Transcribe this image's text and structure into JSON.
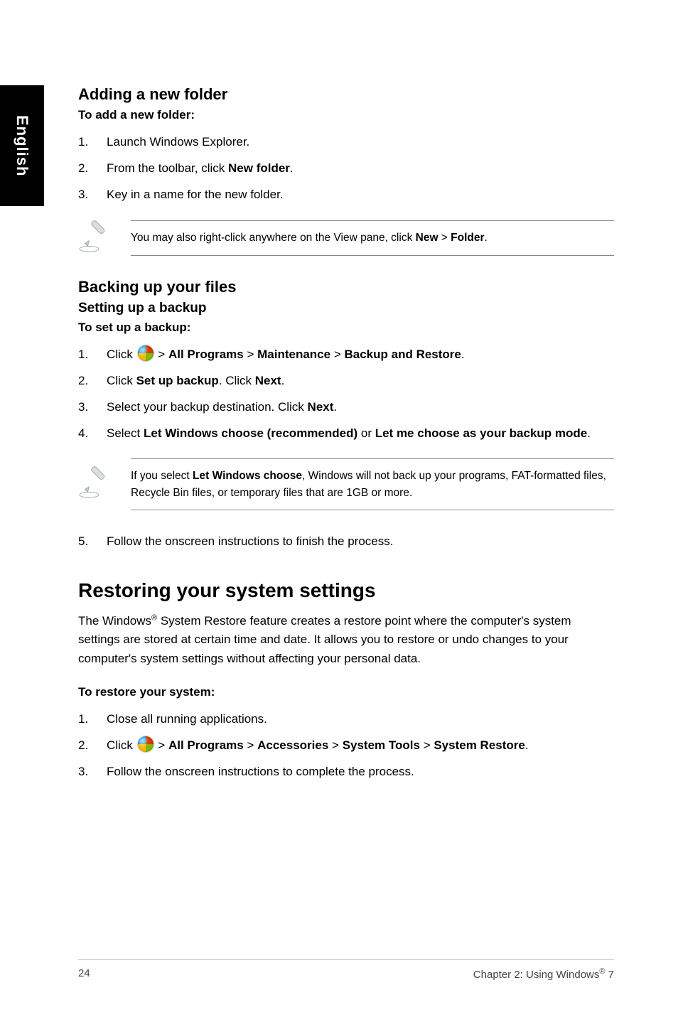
{
  "side_tab": "English",
  "add_folder": {
    "heading": "Adding a new folder",
    "subheading": "To add a new folder:",
    "steps": {
      "s1": {
        "num": "1.",
        "text": "Launch Windows Explorer."
      },
      "s2": {
        "num": "2.",
        "pre": "From the toolbar, click ",
        "bold": "New folder",
        "post": "."
      },
      "s3": {
        "num": "3.",
        "text": "Key in a name for the new folder."
      }
    },
    "note": {
      "pre": "You may also right-click anywhere on the View pane, click ",
      "b1": "New",
      "mid": " > ",
      "b2": "Folder",
      "post": "."
    }
  },
  "backup": {
    "heading": "Backing up your files",
    "subheading": "Setting up a backup",
    "subsub": "To set up a backup:",
    "steps": {
      "s1": {
        "num": "1.",
        "pre": "Click ",
        "mid1": " > ",
        "b1": "All Programs",
        "mid2": " > ",
        "b2": "Maintenance",
        "mid3": " > ",
        "b3": "Backup and Restore",
        "post": "."
      },
      "s2": {
        "num": "2.",
        "pre": "Click ",
        "b1": "Set up backup",
        "mid": ". Click ",
        "b2": "Next",
        "post": "."
      },
      "s3": {
        "num": "3.",
        "pre": "Select your backup destination. Click ",
        "b1": "Next",
        "post": "."
      },
      "s4": {
        "num": "4.",
        "pre": "Select ",
        "b1": "Let Windows choose (recommended)",
        "mid": " or ",
        "b2": "Let me choose as your backup mode",
        "post": "."
      }
    },
    "note": {
      "pre": "If you select ",
      "b1": "Let Windows choose",
      "post": ", Windows will not back up your programs, FAT-formatted files, Recycle Bin files, or temporary files that are 1GB or more."
    },
    "step5": {
      "num": "5.",
      "text": "Follow the onscreen instructions to finish the process."
    }
  },
  "restore": {
    "heading": "Restoring your system settings",
    "para": {
      "pre": "The Windows",
      "sup": "®",
      "post": " System Restore feature creates a restore point where the computer's system settings are stored at certain time and date. It allows you to restore or undo changes to your computer's system settings without affecting your personal data."
    },
    "subheading": "To restore your system:",
    "steps": {
      "s1": {
        "num": "1.",
        "text": "Close all running applications."
      },
      "s2": {
        "num": "2.",
        "pre": "Click ",
        "mid1": " > ",
        "b1": "All Programs",
        "mid2": " > ",
        "b2": "Accessories",
        "mid3": " > ",
        "b3": "System Tools",
        "mid4": " > ",
        "b4": "System Restore",
        "post": "."
      },
      "s3": {
        "num": "3.",
        "text": "Follow the onscreen instructions to complete the process."
      }
    }
  },
  "footer": {
    "page": "24",
    "chapter_pre": "Chapter 2: Using Windows",
    "sup": "®",
    "chapter_post": " 7"
  }
}
